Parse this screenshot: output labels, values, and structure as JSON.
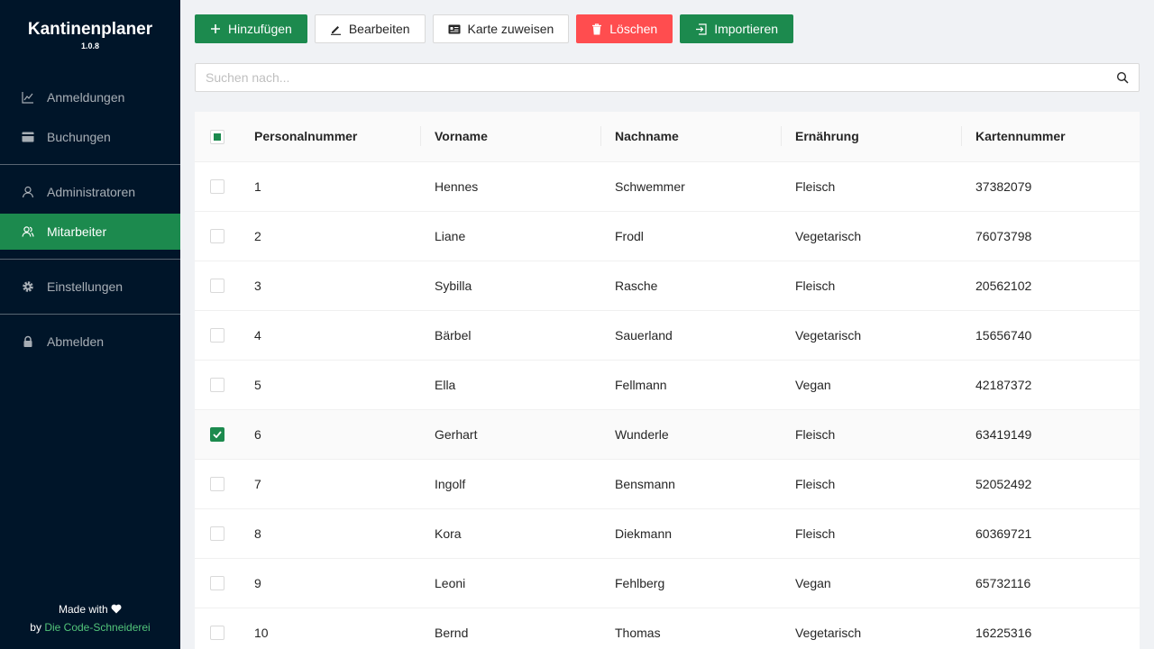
{
  "app": {
    "title": "Kantinenplaner",
    "version": "1.0.8"
  },
  "sidebar": {
    "items": [
      {
        "label": "Anmeldungen",
        "icon": "line-chart-icon"
      },
      {
        "label": "Buchungen",
        "icon": "credit-card-icon"
      },
      {
        "label": "Administratoren",
        "icon": "user-icon"
      },
      {
        "label": "Mitarbeiter",
        "icon": "team-icon",
        "active": true
      },
      {
        "label": "Einstellungen",
        "icon": "gear-icon"
      },
      {
        "label": "Abmelden",
        "icon": "lock-icon"
      }
    ],
    "footer": {
      "made_with": "Made with",
      "by": "by",
      "company": "Die Code-Schneiderei"
    }
  },
  "toolbar": {
    "add": "Hinzufügen",
    "edit": "Bearbeiten",
    "assign_card": "Karte zuweisen",
    "delete": "Löschen",
    "import": "Importieren"
  },
  "search": {
    "placeholder": "Suchen nach..."
  },
  "table": {
    "columns": [
      "Personalnummer",
      "Vorname",
      "Nachname",
      "Ernährung",
      "Kartennummer"
    ],
    "rows": [
      {
        "personalnummer": "1",
        "vorname": "Hennes",
        "nachname": "Schwemmer",
        "ernaehrung": "Fleisch",
        "kartennummer": "37382079",
        "checked": false
      },
      {
        "personalnummer": "2",
        "vorname": "Liane",
        "nachname": "Frodl",
        "ernaehrung": "Vegetarisch",
        "kartennummer": "76073798",
        "checked": false
      },
      {
        "personalnummer": "3",
        "vorname": "Sybilla",
        "nachname": "Rasche",
        "ernaehrung": "Fleisch",
        "kartennummer": "20562102",
        "checked": false
      },
      {
        "personalnummer": "4",
        "vorname": "Bärbel",
        "nachname": "Sauerland",
        "ernaehrung": "Vegetarisch",
        "kartennummer": "15656740",
        "checked": false
      },
      {
        "personalnummer": "5",
        "vorname": "Ella",
        "nachname": "Fellmann",
        "ernaehrung": "Vegan",
        "kartennummer": "42187372",
        "checked": false
      },
      {
        "personalnummer": "6",
        "vorname": "Gerhart",
        "nachname": "Wunderle",
        "ernaehrung": "Fleisch",
        "kartennummer": "63419149",
        "checked": true
      },
      {
        "personalnummer": "7",
        "vorname": "Ingolf",
        "nachname": "Bensmann",
        "ernaehrung": "Fleisch",
        "kartennummer": "52052492",
        "checked": false
      },
      {
        "personalnummer": "8",
        "vorname": "Kora",
        "nachname": "Diekmann",
        "ernaehrung": "Fleisch",
        "kartennummer": "60369721",
        "checked": false
      },
      {
        "personalnummer": "9",
        "vorname": "Leoni",
        "nachname": "Fehlberg",
        "ernaehrung": "Vegan",
        "kartennummer": "65732116",
        "checked": false
      },
      {
        "personalnummer": "10",
        "vorname": "Bernd",
        "nachname": "Thomas",
        "ernaehrung": "Vegetarisch",
        "kartennummer": "16225316",
        "checked": false
      }
    ]
  },
  "colors": {
    "sidebar_bg": "#001529",
    "accent": "#1c8a4e",
    "danger": "#ff4d4f"
  }
}
